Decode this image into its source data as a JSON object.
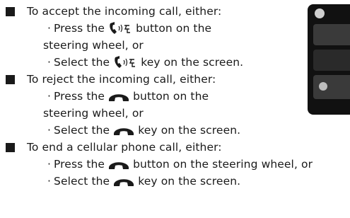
{
  "sections": [
    {
      "heading": "To accept the incoming call, either:",
      "items": [
        {
          "before": "Press the ",
          "icon": "phone-accept-voice-icon",
          "after": " button on the",
          "cont": "steering wheel, or"
        },
        {
          "before": "Select the ",
          "icon": "phone-accept-voice-icon",
          "after": " key on the screen.",
          "cont": ""
        }
      ]
    },
    {
      "heading": "To reject the incoming call, either:",
      "items": [
        {
          "before": "Press the ",
          "icon": "phone-hangup-icon",
          "after": " button on the",
          "cont": "steering wheel, or"
        },
        {
          "before": "Select the ",
          "icon": "phone-hangup-icon",
          "after": " key on the screen.",
          "cont": ""
        }
      ]
    },
    {
      "heading": "To end a cellular phone call, either:",
      "items": [
        {
          "before": "Press the ",
          "icon": "phone-hangup-icon",
          "after": " button on the steering wheel, or",
          "cont": ""
        },
        {
          "before": "Select the ",
          "icon": "phone-hangup-icon",
          "after": " key on the screen.",
          "cont": ""
        }
      ]
    }
  ],
  "colors": {
    "text": "#1a1a1a",
    "screen": "#111111"
  }
}
